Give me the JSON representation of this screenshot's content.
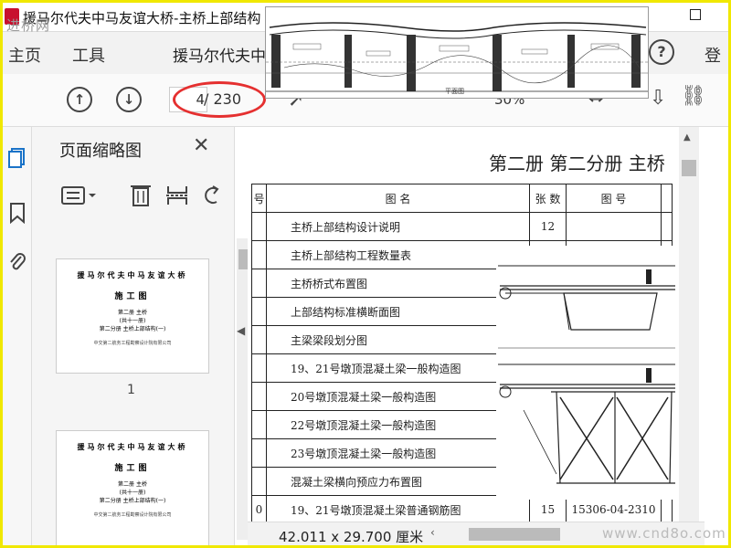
{
  "window": {
    "title": "援马尔代夫中马友谊大桥-主桥上部结构"
  },
  "watermark_top": "进桥网",
  "watermark_bottom": "www.cnd8o.com",
  "menu": {
    "home": "主页",
    "tools": "工具",
    "tab": "援马尔代夫中马",
    "login": "登"
  },
  "toolbar": {
    "page_current": "4",
    "page_total": "/ 230",
    "zoom": "30%"
  },
  "drawing_overlay": {
    "label": "平面图"
  },
  "thumbnails": {
    "title": "页面缩略图",
    "pages": [
      {
        "num": "1",
        "line1": "援马尔代夫中马友谊大桥",
        "line2": "施工图",
        "line3a": "第二册 主桥",
        "line3b": "(共十一册)",
        "line3c": "第二分册 主桥上部结构(一)",
        "line4": "中交第二航务工程勘察设计院有限公司"
      },
      {
        "num": "",
        "line1": "援马尔代夫中马友谊大桥",
        "line2": "施工图",
        "line3a": "第二册 主桥",
        "line3b": "(共十一册)",
        "line3c": "第二分册 主桥上部结构(一)",
        "line4": "中交第二航务工程勘察设计院有限公司"
      }
    ]
  },
  "document": {
    "heading": "第二册 第二分册 主桥",
    "table": {
      "headers": {
        "num": "号",
        "name": "图 名",
        "count": "张 数",
        "code": "图 号"
      },
      "rows": [
        {
          "num": "",
          "name": "主桥上部结构设计说明",
          "count": "12",
          "code": ""
        },
        {
          "num": "",
          "name": "主桥上部结构工程数量表",
          "count": "",
          "code": ""
        },
        {
          "num": "",
          "name": "主桥桥式布置图",
          "count": "",
          "code": ""
        },
        {
          "num": "",
          "name": "上部结构标准横断面图",
          "count": "",
          "code": ""
        },
        {
          "num": "",
          "name": "主梁梁段划分图",
          "count": "",
          "code": ""
        },
        {
          "num": "",
          "name": "19、21号墩顶混凝土梁一般构造图",
          "count": "",
          "code": ""
        },
        {
          "num": "",
          "name": "20号墩顶混凝土梁一般构造图",
          "count": "",
          "code": ""
        },
        {
          "num": "",
          "name": "22号墩顶混凝土梁一般构造图",
          "count": "",
          "code": ""
        },
        {
          "num": "",
          "name": "23号墩顶混凝土梁一般构造图",
          "count": "",
          "code": ""
        },
        {
          "num": "",
          "name": "混凝土梁横向预应力布置图",
          "count": "",
          "code": ""
        },
        {
          "num": "0",
          "name": "19、21号墩顶混凝土梁普通钢筋图",
          "count": "15",
          "code": "15306-04-2310"
        }
      ]
    }
  },
  "status": {
    "dimensions": "42.011 x 29.700 厘米"
  }
}
